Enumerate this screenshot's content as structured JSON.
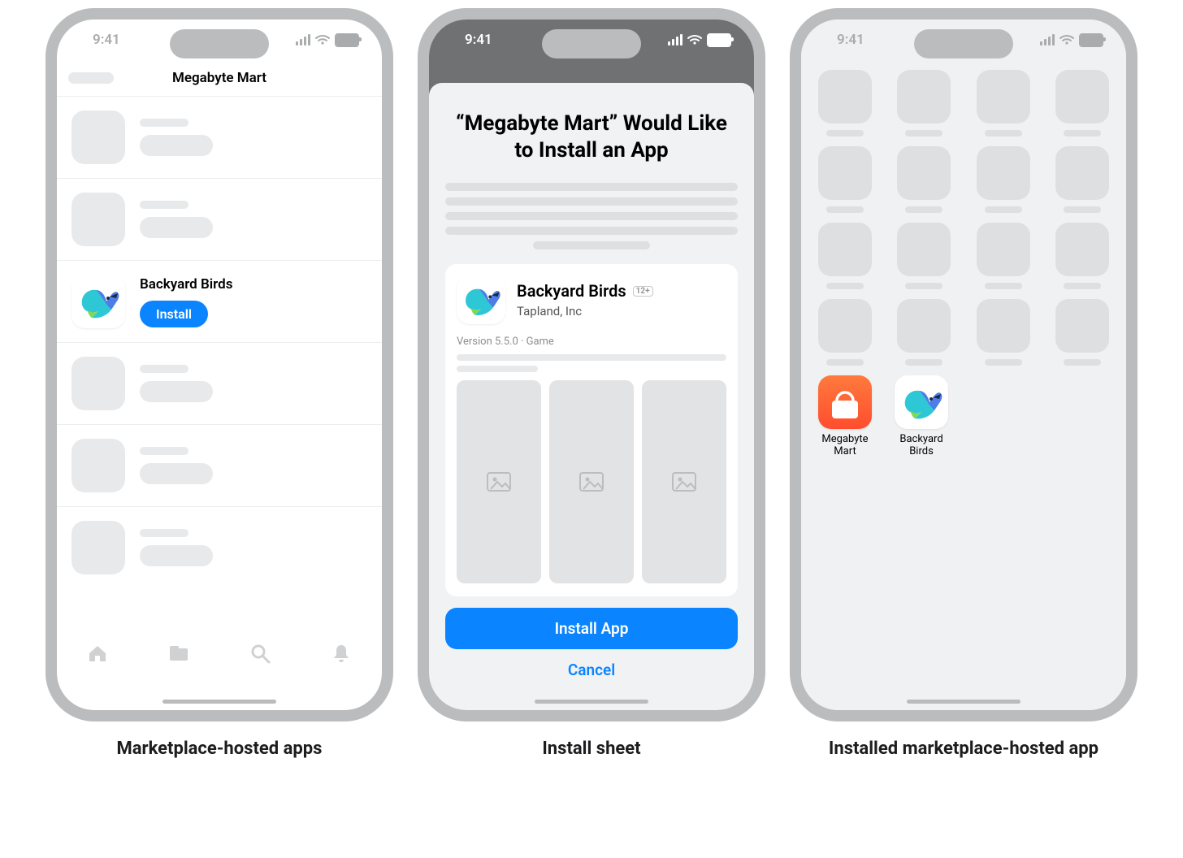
{
  "status_time": "9:41",
  "captions": {
    "c1": "Marketplace-hosted apps",
    "c2": "Install sheet",
    "c3": "Installed marketplace-hosted app"
  },
  "phone1": {
    "title": "Megabyte Mart",
    "app_name": "Backyard Birds",
    "install_label": "Install"
  },
  "phone2": {
    "title": "“Megabyte Mart” Would Like to Install an App",
    "app_name": "Backyard Birds",
    "age_badge": "12+",
    "publisher": "Tapland, Inc",
    "meta": "Version 5.5.0 · Game",
    "install_label": "Install App",
    "cancel_label": "Cancel"
  },
  "phone3": {
    "app1_name": "Megabyte Mart",
    "app2_name": "Backyard Birds"
  }
}
